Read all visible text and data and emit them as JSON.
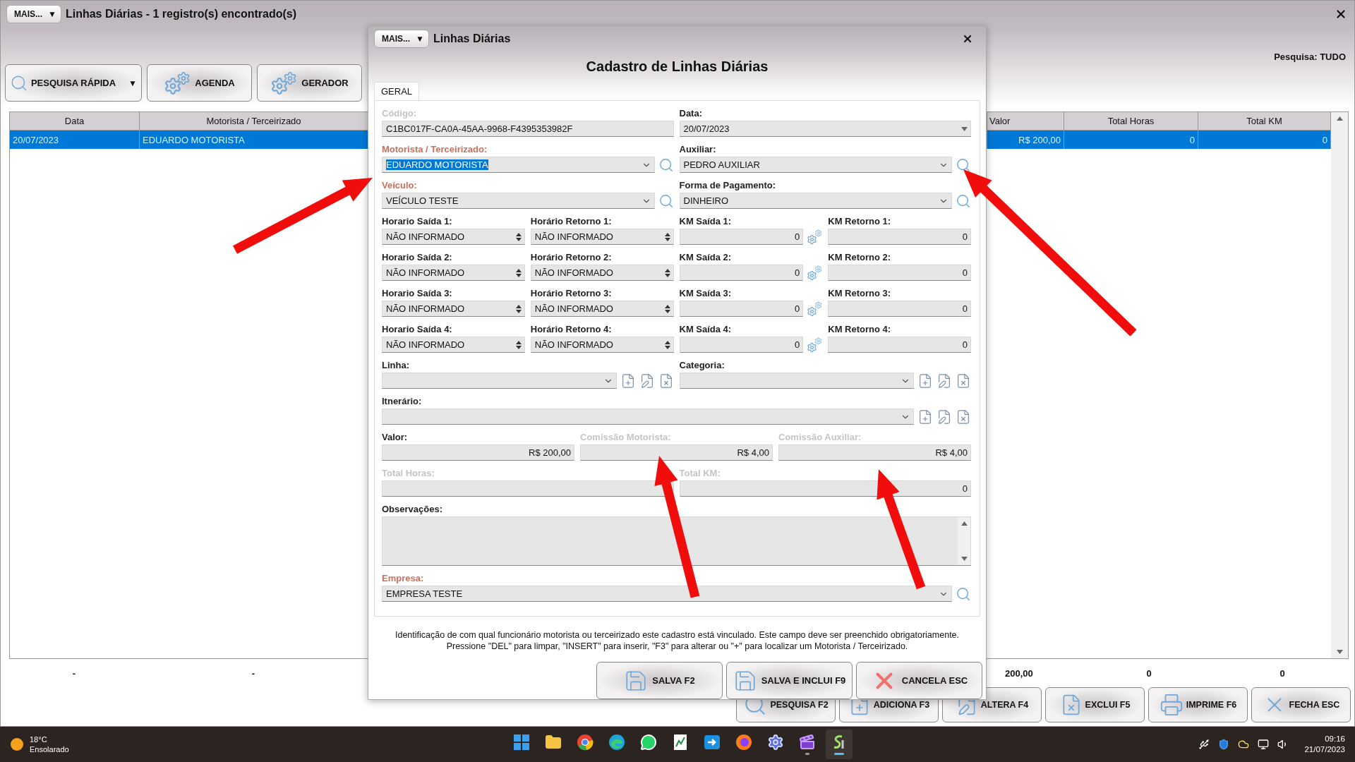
{
  "window": {
    "more_button": "MAIS...",
    "more_arrow": "▼",
    "title": "Linhas Diárias - 1 registro(s) encontrado(s)"
  },
  "toolbar": [
    {
      "label": "PESQUISA RÁPIDA",
      "kind": "search",
      "menu_arrow": "▼"
    },
    {
      "label": "AGENDA",
      "kind": "gears"
    },
    {
      "label": "GERADOR",
      "kind": "gears"
    }
  ],
  "search_scope": "Pesquisa: TUDO",
  "table": {
    "columns": [
      "Data",
      "Motorista / Terceirizado",
      "Valor",
      "Total Horas",
      "Total KM"
    ],
    "rows": [
      {
        "selected": true,
        "cells": [
          "20/07/2023",
          "EDUARDO MOTORISTA",
          "R$ 200,00",
          "0",
          "0"
        ]
      }
    ],
    "totals": [
      "-",
      "-",
      "200,00",
      "0",
      "0"
    ]
  },
  "actions": [
    {
      "label": "PESQUISA F2",
      "kind": "search"
    },
    {
      "label": "ADICIONA F3",
      "kind": "add"
    },
    {
      "label": "ALTERA F4",
      "kind": "edit"
    },
    {
      "label": "EXCLUI F5",
      "kind": "delete"
    },
    {
      "label": "IMPRIME F6",
      "kind": "print"
    },
    {
      "label": "FECHA ESC",
      "kind": "close"
    }
  ],
  "dialog": {
    "more_button": "MAIS...",
    "more_arrow": "▼",
    "title": "Linhas Diárias",
    "heading": "Cadastro de Linhas Diárias",
    "tabs": [
      {
        "label": "GERAL",
        "selected": true
      }
    ],
    "rows": [
      {
        "fields": [
          {
            "label": "Código:",
            "required": false,
            "disabled": true,
            "kind": "text",
            "value": "C1BC017F-CA0A-45AA-9968-F4395353982F"
          },
          {
            "label": "Data:",
            "required": false,
            "disabled": false,
            "kind": "date",
            "value": "20/07/2023"
          }
        ]
      },
      {
        "fields": [
          {
            "label": "Motorista / Terceirizado:",
            "required": true,
            "disabled": false,
            "kind": "combo",
            "value": "EDUARDO MOTORISTA",
            "highlighted": true,
            "search": true
          },
          {
            "label": "Auxiliar:",
            "required": false,
            "disabled": false,
            "kind": "combo",
            "value": "PEDRO AUXILIAR",
            "highlighted": false,
            "search": true
          }
        ]
      },
      {
        "fields": [
          {
            "label": "Veículo:",
            "required": true,
            "disabled": false,
            "kind": "combo",
            "value": "VEÍCULO TESTE",
            "highlighted": false,
            "search": true
          },
          {
            "label": "Forma de Pagamento:",
            "required": false,
            "disabled": false,
            "kind": "combo",
            "value": "DINHEIRO",
            "highlighted": false,
            "search": true
          }
        ]
      },
      {
        "fields": [
          {
            "label": "Horario Saída 1:",
            "required": false,
            "disabled": false,
            "kind": "spin",
            "value": "NÃO INFORMADO"
          },
          {
            "label": "Horário Retorno 1:",
            "required": false,
            "disabled": false,
            "kind": "spin",
            "value": "NÃO INFORMADO"
          },
          {
            "label": "KM Saída 1:",
            "required": false,
            "disabled": false,
            "kind": "number",
            "value": "0",
            "settings": true
          },
          {
            "label": "KM Retorno 1:",
            "required": false,
            "disabled": false,
            "kind": "number",
            "value": "0"
          }
        ]
      },
      {
        "fields": [
          {
            "label": "Horario Saída 2:",
            "required": false,
            "disabled": false,
            "kind": "spin",
            "value": "NÃO INFORMADO"
          },
          {
            "label": "Horário Retorno 2:",
            "required": false,
            "disabled": false,
            "kind": "spin",
            "value": "NÃO INFORMADO"
          },
          {
            "label": "KM Saída 2:",
            "required": false,
            "disabled": false,
            "kind": "number",
            "value": "0",
            "settings": true
          },
          {
            "label": "KM Retorno 2:",
            "required": false,
            "disabled": false,
            "kind": "number",
            "value": "0"
          }
        ]
      },
      {
        "fields": [
          {
            "label": "Horario Saída 3:",
            "required": false,
            "disabled": false,
            "kind": "spin",
            "value": "NÃO INFORMADO"
          },
          {
            "label": "Horário Retorno 3:",
            "required": false,
            "disabled": false,
            "kind": "spin",
            "value": "NÃO INFORMADO"
          },
          {
            "label": "KM Saída 3:",
            "required": false,
            "disabled": false,
            "kind": "number",
            "value": "0",
            "settings": true
          },
          {
            "label": "KM Retorno 3:",
            "required": false,
            "disabled": false,
            "kind": "number",
            "value": "0"
          }
        ]
      },
      {
        "fields": [
          {
            "label": "Horario Saída 4:",
            "required": false,
            "disabled": false,
            "kind": "spin",
            "value": "NÃO INFORMADO"
          },
          {
            "label": "Horário Retorno 4:",
            "required": false,
            "disabled": false,
            "kind": "spin",
            "value": "NÃO INFORMADO"
          },
          {
            "label": "KM Saída 4:",
            "required": false,
            "disabled": false,
            "kind": "number",
            "value": "0",
            "settings": true
          },
          {
            "label": "KM Retorno 4:",
            "required": false,
            "disabled": false,
            "kind": "number",
            "value": "0"
          }
        ]
      },
      {
        "fields": [
          {
            "label": "Linha:",
            "required": false,
            "disabled": false,
            "kind": "combo",
            "file_actions": true
          },
          {
            "label": "Categoria:",
            "required": false,
            "disabled": false,
            "kind": "combo",
            "file_actions": true
          }
        ]
      },
      {
        "fields": [
          {
            "label": "Itnerário:",
            "required": false,
            "disabled": false,
            "kind": "combo",
            "file_actions": true
          }
        ]
      },
      {
        "fields": [
          {
            "label": "Valor:",
            "required": false,
            "disabled": false,
            "kind": "number",
            "value": "R$ 200,00"
          },
          {
            "label": "Comissão Motorista:",
            "required": false,
            "disabled": true,
            "kind": "number",
            "value": "R$ 4,00"
          },
          {
            "label": "Comissão Auxiliar:",
            "required": false,
            "disabled": true,
            "kind": "number",
            "value": "R$ 4,00"
          }
        ]
      },
      {
        "fields": [
          {
            "label": "Total Horas:",
            "required": false,
            "disabled": true,
            "kind": "number"
          },
          {
            "label": "Total KM:",
            "required": false,
            "disabled": true,
            "kind": "number",
            "value": "0"
          }
        ]
      },
      {
        "fields": [
          {
            "label": "Observações:",
            "required": false,
            "disabled": false,
            "kind": "textarea"
          }
        ]
      },
      {
        "fields": [
          {
            "label": "Empresa:",
            "required": true,
            "disabled": false,
            "kind": "combo",
            "value": "EMPRESA TESTE",
            "highlighted": false,
            "search": true
          }
        ]
      }
    ],
    "hint_lines": [
      "Identificação de com qual funcionário motorista ou terceirizado este cadastro está vinculado. Este campo deve ser preenchido obrigatoriamente.",
      "Pressione \"DEL\" para limpar, \"INSERT\" para inserir, \"F3\" para alterar ou \"+\" para localizar um Motorista / Terceirizado."
    ],
    "buttons": [
      {
        "label": "SALVA F2",
        "kind": "save"
      },
      {
        "label": "SALVA E INCLUI F9",
        "kind": "save"
      },
      {
        "label": "CANCELA ESC",
        "kind": "cancel"
      }
    ]
  },
  "taskbar": {
    "weather": {
      "temp": "18°C",
      "condition": "Ensolarado"
    },
    "apps": [
      {
        "kind": "windows",
        "running": false,
        "active": false
      },
      {
        "kind": "folder",
        "running": false,
        "active": false
      },
      {
        "kind": "chrome",
        "running": false,
        "active": false
      },
      {
        "kind": "edge",
        "running": false,
        "active": false
      },
      {
        "kind": "chat",
        "running": false,
        "active": false
      },
      {
        "kind": "sheet",
        "running": false,
        "active": false
      },
      {
        "kind": "remote",
        "running": false,
        "active": false
      },
      {
        "kind": "firefox",
        "running": false,
        "active": false
      },
      {
        "kind": "gear",
        "running": false,
        "active": false
      },
      {
        "kind": "video",
        "running": true,
        "active": false
      },
      {
        "kind": "app",
        "running": true,
        "active": true
      }
    ],
    "time": "09:16",
    "date": "21/07/2023"
  }
}
